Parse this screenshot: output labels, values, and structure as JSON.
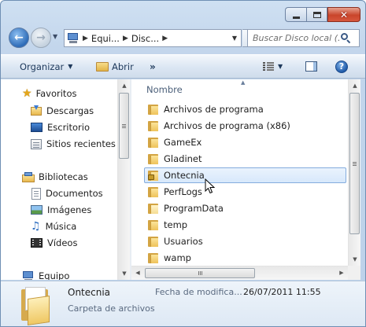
{
  "window": {
    "address": {
      "crumbs": [
        "Equi...",
        "Disc..."
      ],
      "icon": "computer-icon"
    },
    "search": {
      "placeholder": "Buscar Disco local (..."
    },
    "icons": {
      "minimize": "minimize-icon",
      "maximize": "maximize-icon",
      "close": "close-icon",
      "refresh": "refresh-icon"
    }
  },
  "command_bar": {
    "organize_label": "Organizar",
    "open_label": "Abrir",
    "more_label": "»"
  },
  "nav_pane": {
    "favorites": {
      "label": "Favoritos",
      "items": [
        {
          "label": "Descargas",
          "icon": "downloads-icon"
        },
        {
          "label": "Escritorio",
          "icon": "desktop-icon"
        },
        {
          "label": "Sitios recientes",
          "icon": "recent-places-icon"
        }
      ]
    },
    "libraries": {
      "label": "Bibliotecas",
      "items": [
        {
          "label": "Documentos",
          "icon": "documents-icon"
        },
        {
          "label": "Imágenes",
          "icon": "pictures-icon"
        },
        {
          "label": "Música",
          "icon": "music-icon"
        },
        {
          "label": "Vídeos",
          "icon": "videos-icon"
        }
      ]
    },
    "computer": {
      "label": "Equipo"
    }
  },
  "file_list": {
    "column_name": "Nombre",
    "items": [
      {
        "name": "Archivos de programa",
        "selected": false,
        "icon": "folder-icon"
      },
      {
        "name": "Archivos de programa (x86)",
        "selected": false,
        "icon": "folder-icon"
      },
      {
        "name": "GameEx",
        "selected": false,
        "icon": "folder-icon"
      },
      {
        "name": "Gladinet",
        "selected": false,
        "icon": "folder-icon"
      },
      {
        "name": "Ontecnia",
        "selected": true,
        "icon": "locked-folder-icon"
      },
      {
        "name": "PerfLogs",
        "selected": false,
        "icon": "folder-icon"
      },
      {
        "name": "ProgramData",
        "selected": false,
        "icon": "hidden-folder-icon"
      },
      {
        "name": "temp",
        "selected": false,
        "icon": "folder-icon"
      },
      {
        "name": "Usuarios",
        "selected": false,
        "icon": "folder-icon"
      },
      {
        "name": "wamp",
        "selected": false,
        "icon": "folder-icon"
      }
    ]
  },
  "details": {
    "name": "Ontecnia",
    "type": "Carpeta de archivos",
    "date_label": "Fecha de modifica...",
    "date_value": "26/07/2011 11:55"
  },
  "colors": {
    "selection_border": "#84acdd",
    "selection_fill": "#d7e8fb",
    "close_button": "#c9452b",
    "command_text": "#1e395b"
  }
}
